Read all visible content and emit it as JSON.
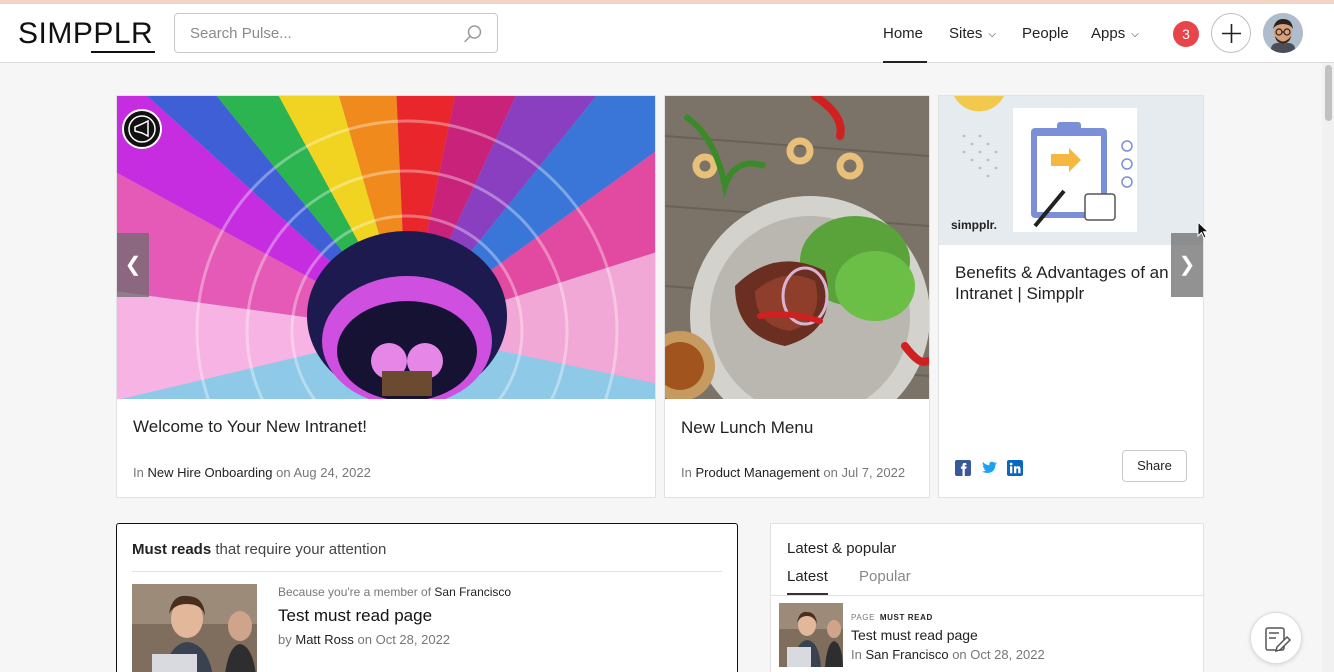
{
  "header": {
    "logo": "SIMPPLR",
    "search_placeholder": "Search Pulse...",
    "nav": [
      {
        "label": "Home",
        "active": true
      },
      {
        "label": "Sites",
        "dropdown": true
      },
      {
        "label": "People"
      },
      {
        "label": "Apps",
        "dropdown": true
      }
    ],
    "notification_count": "3"
  },
  "carousel": {
    "cards": [
      {
        "title": "Welcome to Your New Intranet!",
        "meta_prefix": "In",
        "site": "New Hire Onboarding",
        "meta_mid": "on",
        "date": "Aug 24, 2022"
      },
      {
        "title": "New Lunch Menu",
        "meta_prefix": "In",
        "site": "Product Management",
        "meta_mid": "on",
        "date": "Jul 7, 2022"
      },
      {
        "title": "Benefits & Advantages of an Intranet | Simpplr",
        "image_text": "simpplr.",
        "share_label": "Share"
      }
    ]
  },
  "must_reads": {
    "title_bold": "Must reads",
    "title_rest": "that require your attention",
    "item": {
      "reason_prefix": "Because you're a member of",
      "reason_site": "San Francisco",
      "title": "Test must read page",
      "by_prefix": "by",
      "author": "Matt Ross",
      "date_prefix": "on",
      "date": "Oct 28, 2022"
    }
  },
  "latest_popular": {
    "title": "Latest & popular",
    "tabs": [
      "Latest",
      "Popular"
    ],
    "item": {
      "tag1": "PAGE",
      "tag2": "MUST READ",
      "title": "Test must read page",
      "in_prefix": "In",
      "site": "San Francisco",
      "date_prefix": "on",
      "date": "Oct 28, 2022"
    }
  },
  "colors": {
    "accent_badge": "#e8454b",
    "facebook": "#3b5998",
    "twitter": "#1da1f2",
    "linkedin": "#0a66c2"
  }
}
